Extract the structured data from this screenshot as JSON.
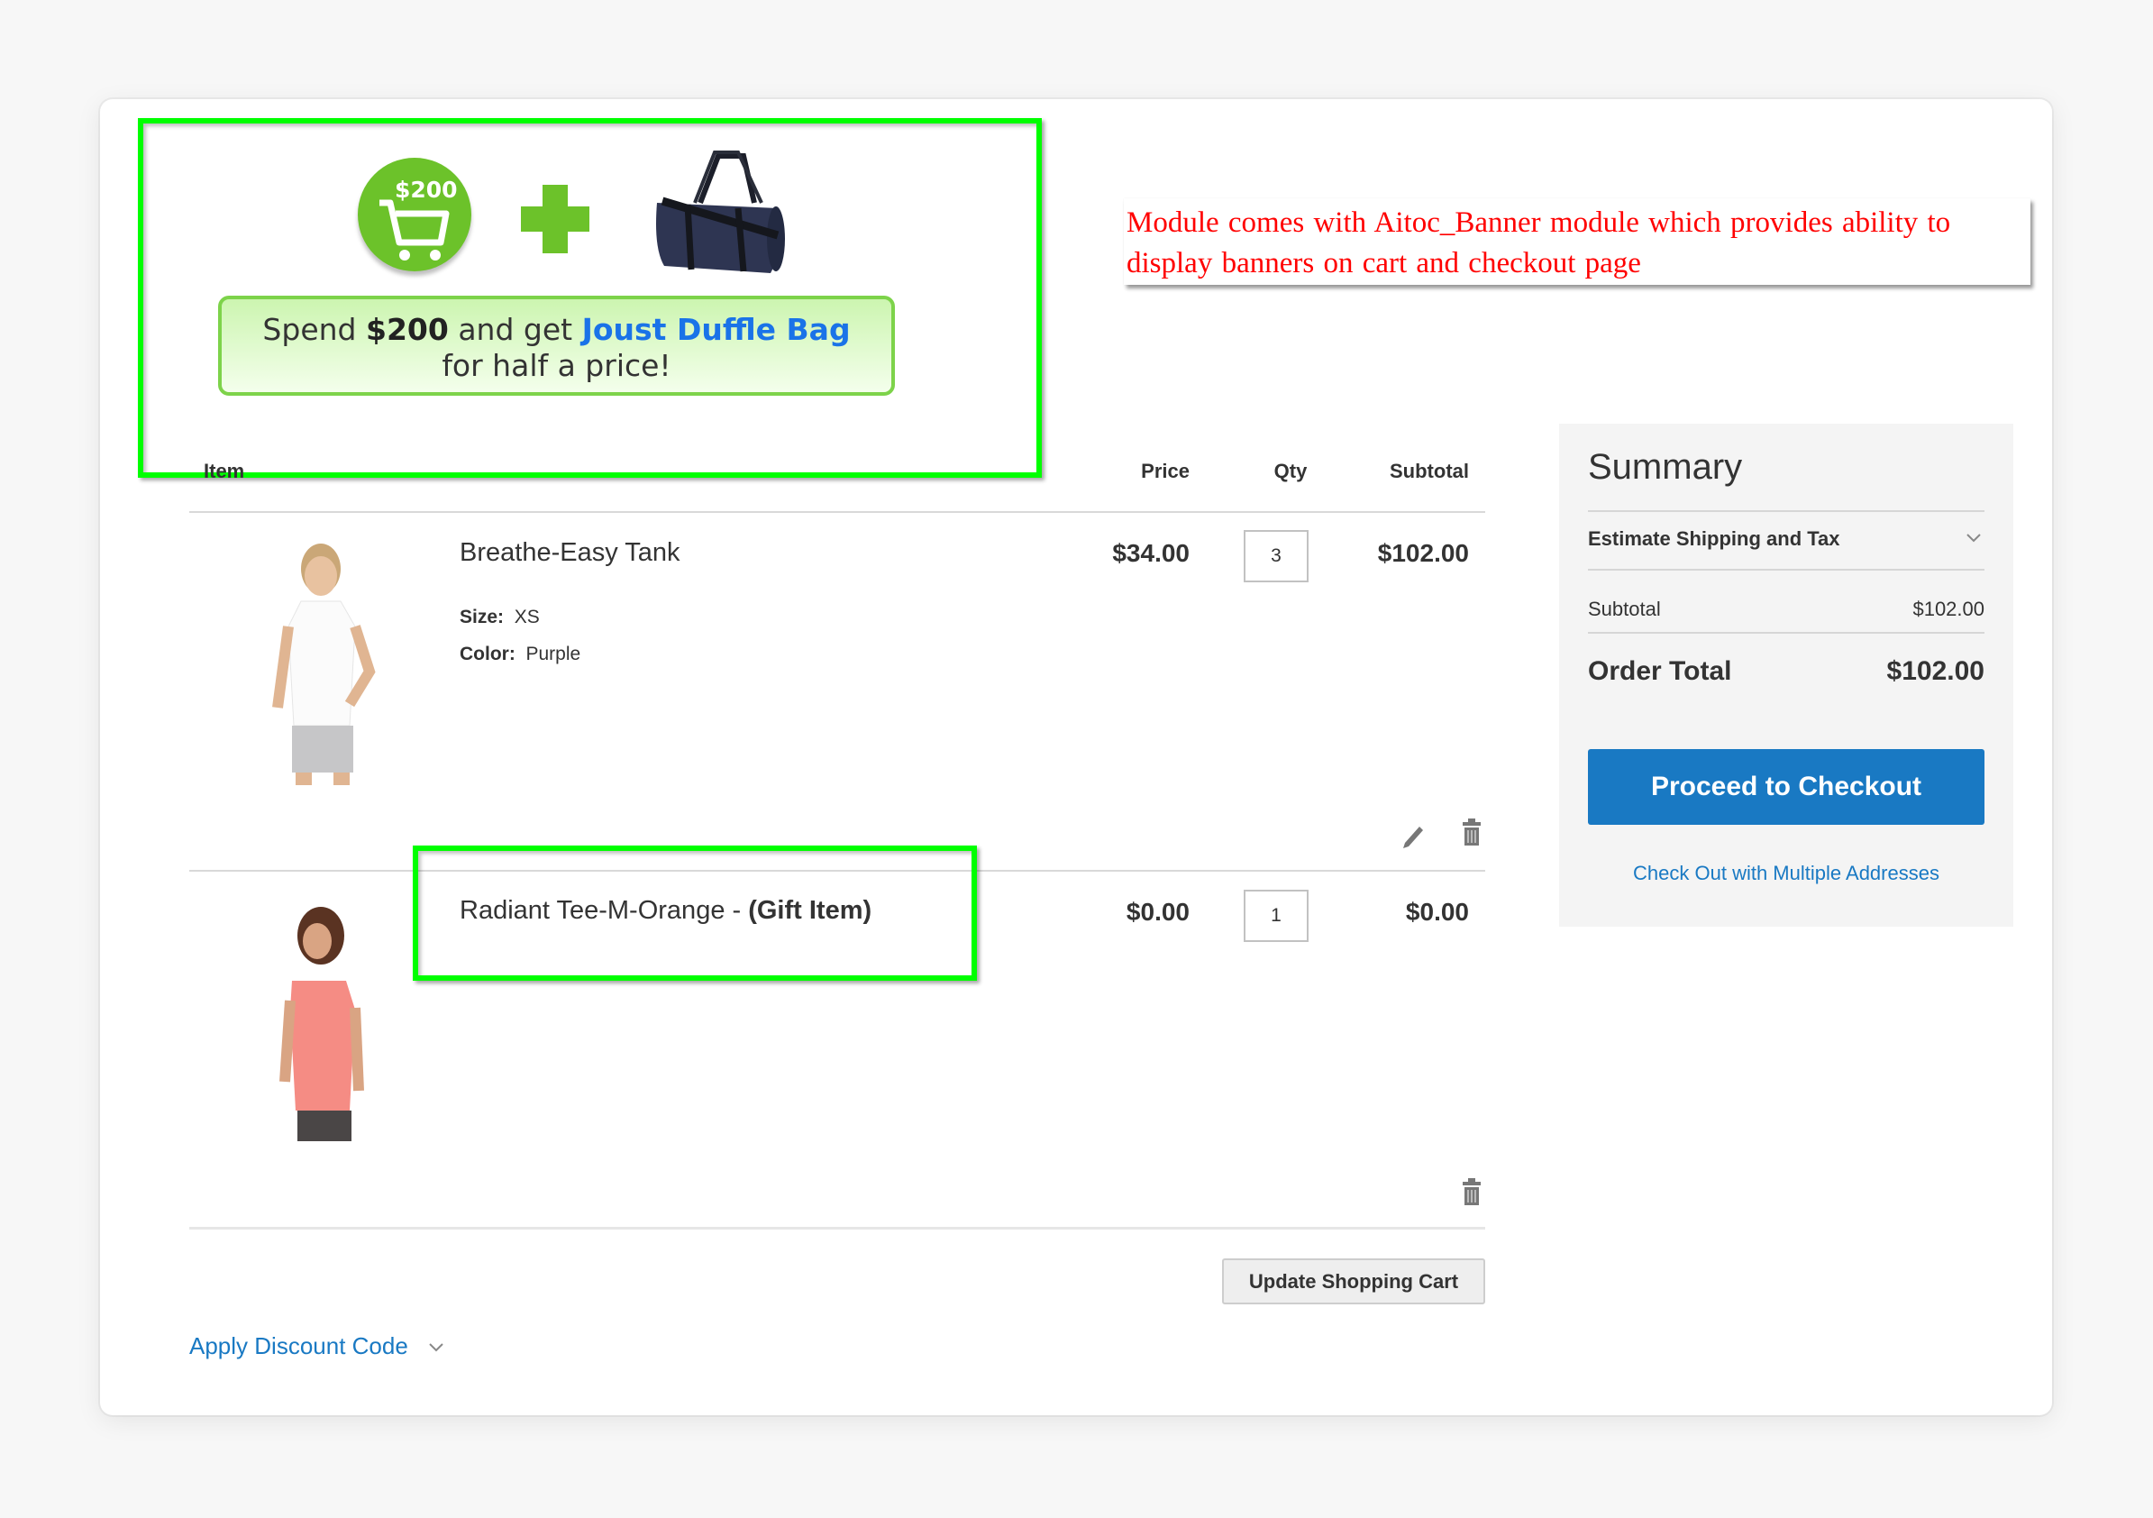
{
  "banner": {
    "cart_amount": "$200",
    "promo_prefix": "Spend ",
    "promo_amount": "$200",
    "promo_middle": " and get ",
    "promo_product": "Joust Duffle Bag",
    "promo_suffix": "for half a price!",
    "icons": [
      "cart-icon",
      "plus-icon",
      "duffle-bag-image"
    ],
    "accent_color": "#6cc22a"
  },
  "annotation": {
    "text": "Module comes with Aitoc_Banner module which provides ability to display banners on cart and checkout page",
    "color": "#ff0000"
  },
  "table": {
    "headers": {
      "item": "Item",
      "price": "Price",
      "qty": "Qty",
      "subtotal": "Subtotal"
    },
    "rows": [
      {
        "name": "Breathe-Easy Tank",
        "options": [
          {
            "label": "Size:",
            "value": "XS"
          },
          {
            "label": "Color:",
            "value": "Purple"
          }
        ],
        "price": "$34.00",
        "qty": "3",
        "subtotal": "$102.00",
        "actions": [
          "edit-icon",
          "trash-icon"
        ]
      },
      {
        "name": "Radiant Tee-M-Orange - ",
        "gift_label": "(Gift Item)",
        "price": "$0.00",
        "qty": "1",
        "subtotal": "$0.00",
        "actions": [
          "trash-icon"
        ]
      }
    ]
  },
  "actions": {
    "update_cart": "Update Shopping Cart",
    "apply_discount": "Apply Discount Code"
  },
  "summary": {
    "title": "Summary",
    "estimate_label": "Estimate Shipping and Tax",
    "subtotal_label": "Subtotal",
    "subtotal_value": "$102.00",
    "order_total_label": "Order Total",
    "order_total_value": "$102.00",
    "checkout_button": "Proceed to Checkout",
    "multi_address_link": "Check Out with Multiple Addresses",
    "button_color": "#1979c3"
  }
}
